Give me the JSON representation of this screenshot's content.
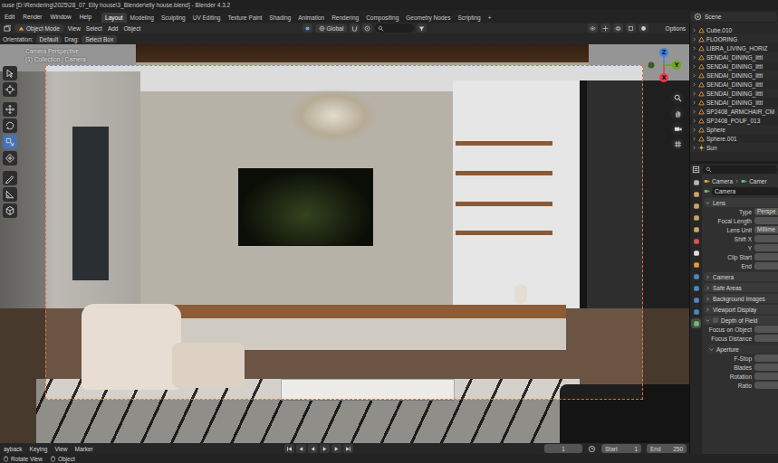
{
  "window": {
    "title": "ouse [D:\\Rendering\\2025\\28_07_Elly house\\3_Blender\\elly house.blend] - Blender 4.3.2"
  },
  "menu": [
    "Edit",
    "Render",
    "Window",
    "Help"
  ],
  "workspaces": [
    {
      "label": "Layout",
      "selected": true
    },
    {
      "label": "Modeling",
      "selected": false
    },
    {
      "label": "Sculpting",
      "selected": false
    },
    {
      "label": "UV Editing",
      "selected": false
    },
    {
      "label": "Texture Paint",
      "selected": false
    },
    {
      "label": "Shading",
      "selected": false
    },
    {
      "label": "Animation",
      "selected": false
    },
    {
      "label": "Rendering",
      "selected": false
    },
    {
      "label": "Compositing",
      "selected": false
    },
    {
      "label": "Geometry Nodes",
      "selected": false
    },
    {
      "label": "Scripting",
      "selected": false
    }
  ],
  "add_workspace": "+",
  "scene": {
    "label": "Scene"
  },
  "viewport_header": {
    "mode": "Object Mode",
    "menus": [
      "View",
      "Select",
      "Add",
      "Object"
    ],
    "transform": "Global",
    "options": "Options"
  },
  "tool_settings": {
    "orientation_label": "Orientation:",
    "orientation": "Default",
    "drag_label": "Drag:",
    "drag": "Select Box"
  },
  "toolbar": [
    {
      "selected": false
    },
    {
      "selected": false
    },
    {
      "selected": false
    },
    {
      "selected": false
    },
    {
      "selected": true
    },
    {
      "selected": false
    },
    {
      "selected": false
    },
    {
      "selected": false
    },
    {
      "selected": false
    }
  ],
  "viewport": {
    "view_name": "Camera Perspective",
    "collection": "(1) Collection | Camera"
  },
  "gizmo": {
    "axes": [
      {
        "label": "Z",
        "color": "#3b83e8"
      },
      {
        "label": "Y",
        "color": "#6ba81e"
      },
      {
        "label": "X",
        "color": "#e83a4c"
      }
    ]
  },
  "outliner": {
    "items": [
      {
        "label": "Cube.010",
        "kind": "mesh"
      },
      {
        "label": "FLOORING",
        "kind": "mesh"
      },
      {
        "label": "LIBRA_LIVING_HORIZ",
        "kind": "mesh"
      },
      {
        "label": "SENDAI_DINING_littl",
        "kind": "mesh"
      },
      {
        "label": "SENDAI_DINING_littl",
        "kind": "mesh"
      },
      {
        "label": "SENDAI_DINING_littl",
        "kind": "mesh"
      },
      {
        "label": "SENDAI_DINING_littl",
        "kind": "mesh"
      },
      {
        "label": "SENDAI_DINING_littl",
        "kind": "mesh"
      },
      {
        "label": "SENDAI_DINING_littl",
        "kind": "mesh"
      },
      {
        "label": "SP2408_ARMCHAIR_CM",
        "kind": "mesh"
      },
      {
        "label": "SP2408_POUF_013",
        "kind": "mesh"
      },
      {
        "label": "Sphere",
        "kind": "mesh"
      },
      {
        "label": "Sphere.001",
        "kind": "mesh"
      },
      {
        "label": "Sun",
        "kind": "light"
      }
    ]
  },
  "properties": {
    "tabs": [
      {
        "color": "#b8b8b8",
        "selected": false
      },
      {
        "color": "#c9a56b",
        "selected": false
      },
      {
        "color": "#c9a56b",
        "selected": false
      },
      {
        "color": "#c9a56b",
        "selected": false
      },
      {
        "color": "#c9a56b",
        "selected": false
      },
      {
        "color": "#d9544f",
        "selected": false
      },
      {
        "color": "#e0e0e0",
        "selected": false
      },
      {
        "color": "#e79a3c",
        "selected": false
      },
      {
        "color": "#4f86c6",
        "selected": false
      },
      {
        "color": "#4f86c6",
        "selected": false
      },
      {
        "color": "#4f86c6",
        "selected": false
      },
      {
        "color": "#4f86c6",
        "selected": false
      },
      {
        "color": "#6bbf6b",
        "selected": true
      }
    ],
    "breadcrumb": [
      "Camera",
      "Camer"
    ],
    "object_name": "Camera",
    "sections": [
      {
        "title": "Lens",
        "kind": "panel",
        "expanded": true,
        "rows": [
          {
            "label": "Type",
            "value": "Perspe"
          },
          {
            "label": "Focal Length"
          },
          {
            "label": "Lens Unit",
            "value": "Millime"
          },
          {
            "label": "Shift X"
          },
          {
            "label": "Y"
          },
          {
            "label": "Clip Start"
          },
          {
            "label": "End"
          }
        ]
      },
      {
        "title": "Camera",
        "kind": "panel",
        "expanded": false,
        "rows": []
      },
      {
        "title": "Safe Areas",
        "kind": "panel",
        "expanded": false,
        "rows": []
      },
      {
        "title": "Background Images",
        "kind": "panel",
        "expanded": false,
        "rows": []
      },
      {
        "title": "Viewport Display",
        "kind": "panel",
        "expanded": false,
        "rows": []
      },
      {
        "title": "Depth of Field",
        "kind": "check-panel",
        "checked": false,
        "expanded": true,
        "rows": [
          {
            "label": "Focus on Object"
          },
          {
            "label": "Focus Distance"
          }
        ]
      },
      {
        "title": "Aperture",
        "kind": "subpanel",
        "expanded": true,
        "rows": [
          {
            "label": "F-Stop"
          },
          {
            "label": "Blades"
          },
          {
            "label": "Rotation"
          },
          {
            "label": "Ratio"
          }
        ]
      }
    ]
  },
  "timeline": {
    "menus": [
      "ayback",
      "Keying",
      "View",
      "Marker"
    ],
    "frame": "1",
    "start_label": "Start",
    "start": "1",
    "end_label": "End",
    "end": "250"
  },
  "statusbar": {
    "items": [
      {
        "label": "Rotate View"
      },
      {
        "label": "Object"
      }
    ]
  }
}
